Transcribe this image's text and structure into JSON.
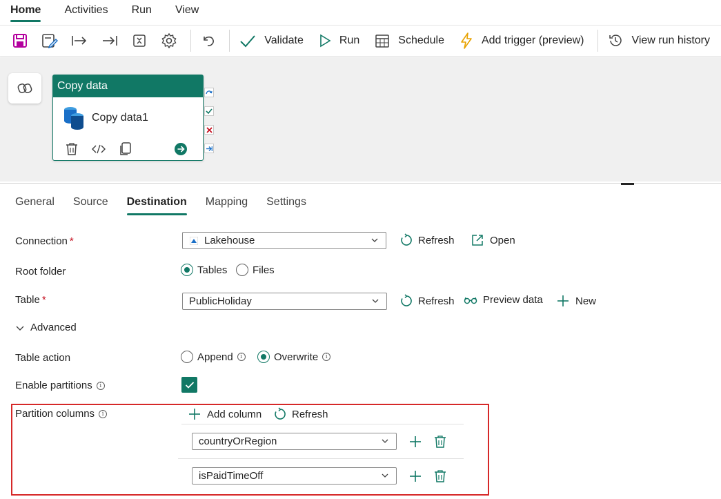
{
  "menu": {
    "tabs": [
      {
        "label": "Home",
        "active": true
      },
      {
        "label": "Activities"
      },
      {
        "label": "Run"
      },
      {
        "label": "View"
      }
    ]
  },
  "toolbar": {
    "icons": [
      "save-icon",
      "save-as-template-icon",
      "move-right-icon",
      "move-end-icon",
      "expand-icon",
      "settings-gear-icon",
      "undo-icon"
    ],
    "validate_label": "Validate",
    "run_label": "Run",
    "schedule_label": "Schedule",
    "trigger_label": "Add trigger (preview)",
    "history_label": "View run history"
  },
  "canvas": {
    "activity": {
      "header": "Copy data",
      "name": "Copy data1"
    }
  },
  "properties": {
    "tabs": [
      "General",
      "Source",
      "Destination",
      "Mapping",
      "Settings"
    ],
    "active_tab": "Destination",
    "connection": {
      "label": "Connection",
      "required": "*",
      "value": "Lakehouse",
      "refresh": "Refresh",
      "open": "Open"
    },
    "root_folder": {
      "label": "Root folder",
      "options": [
        "Tables",
        "Files"
      ],
      "selected": "Tables"
    },
    "table": {
      "label": "Table",
      "required": "*",
      "value": "PublicHoliday",
      "refresh": "Refresh",
      "preview": "Preview data",
      "new": "New"
    },
    "advanced": {
      "label": "Advanced"
    },
    "table_action": {
      "label": "Table action",
      "options": [
        "Append",
        "Overwrite"
      ],
      "selected": "Overwrite"
    },
    "enable_partitions": {
      "label": "Enable partitions",
      "checked": true
    },
    "partition_columns": {
      "label": "Partition columns",
      "add": "Add column",
      "refresh": "Refresh",
      "columns": [
        "countryOrRegion",
        "isPaidTimeOff"
      ]
    }
  },
  "colors": {
    "accent": "#117865",
    "highlight": "#d62828",
    "save": "#b4009e"
  }
}
